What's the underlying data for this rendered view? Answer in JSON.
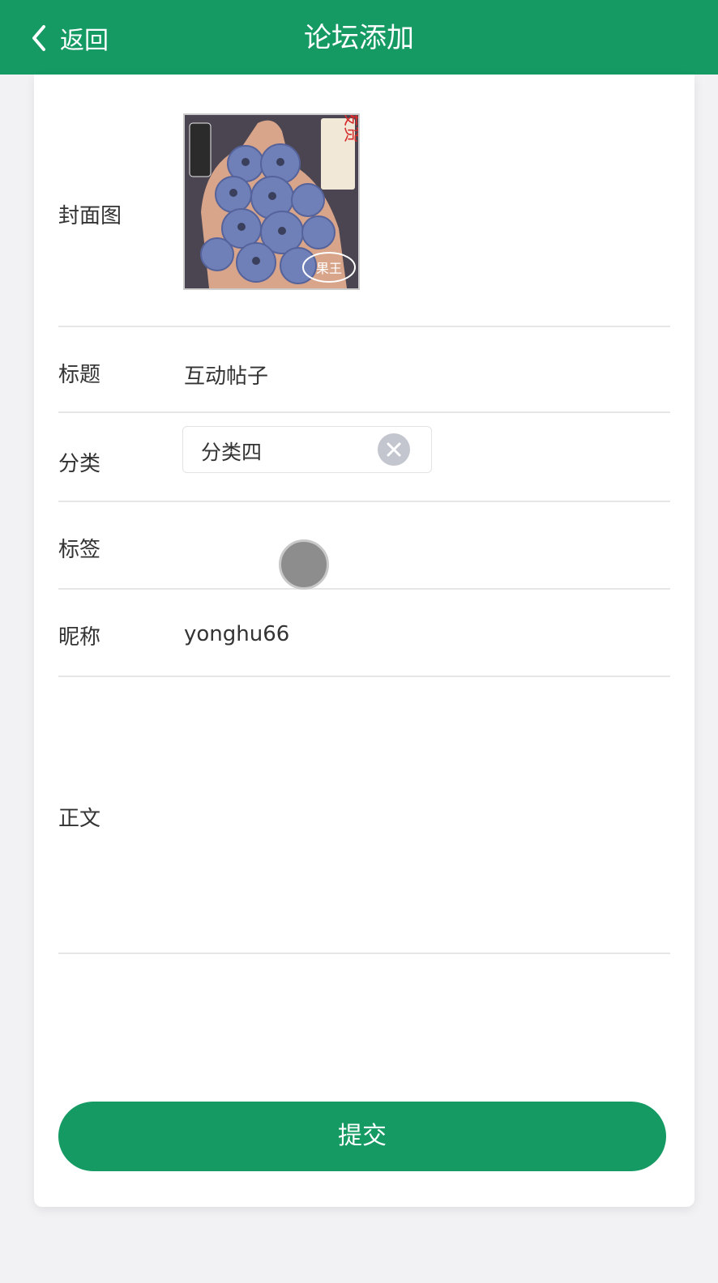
{
  "header": {
    "back_label": "返回",
    "title": "论坛添加"
  },
  "form": {
    "cover": {
      "label": "封面图",
      "image_text_top": "当天发货",
      "image_text_bottom": "果王"
    },
    "title": {
      "label": "标题",
      "value": "互动帖子"
    },
    "category": {
      "label": "分类",
      "value": "分类四"
    },
    "tags": {
      "label": "标签",
      "value": ""
    },
    "nickname": {
      "label": "昵称",
      "value": "yonghu66"
    },
    "body": {
      "label": "正文",
      "value": ""
    }
  },
  "submit_label": "提交",
  "colors": {
    "primary": "#159a64",
    "background": "#f2f2f4"
  }
}
